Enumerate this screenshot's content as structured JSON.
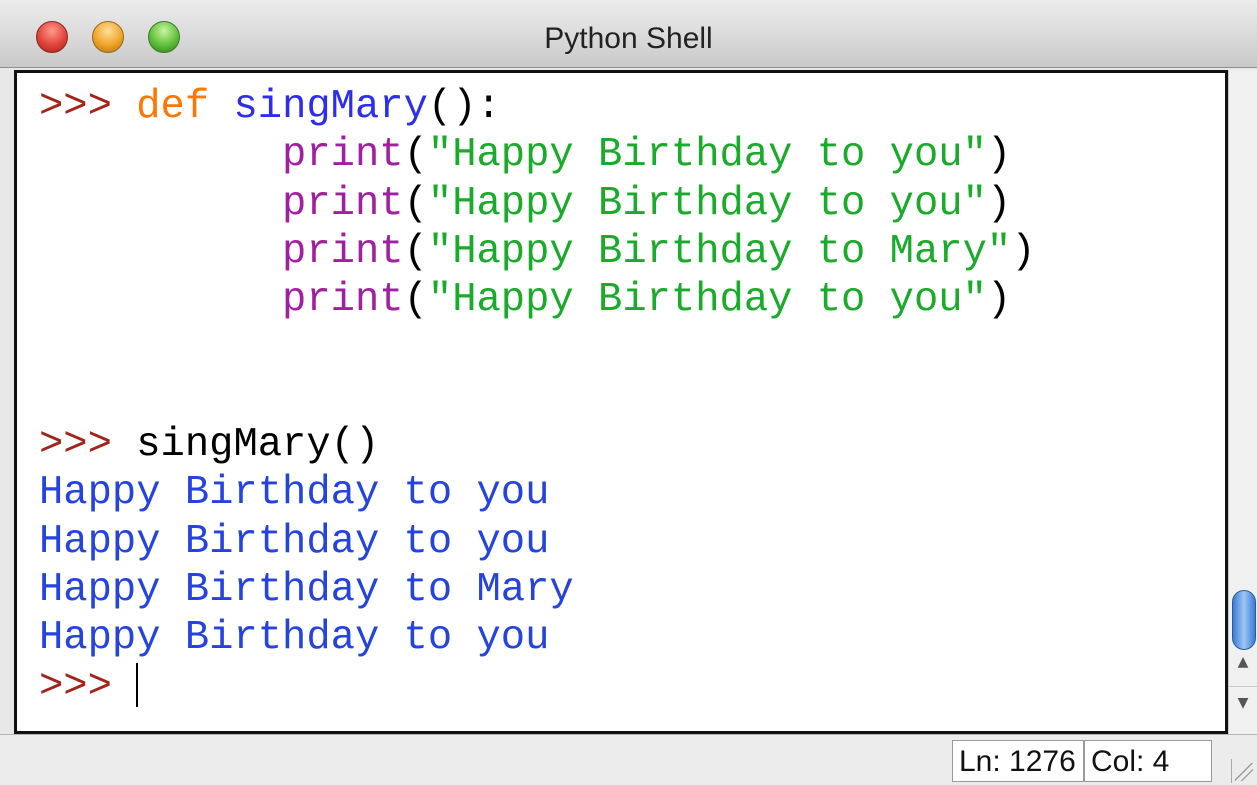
{
  "window": {
    "title": "Python Shell",
    "traffic_lights": [
      "close",
      "minimize",
      "zoom"
    ]
  },
  "shell": {
    "prompt": ">>>",
    "definition": {
      "keyword": "def",
      "function_name": "singMary",
      "signature_rest": "():",
      "body": [
        {
          "builtin": "print",
          "open": "(",
          "string": "\"Happy Birthday to you\"",
          "close": ")"
        },
        {
          "builtin": "print",
          "open": "(",
          "string": "\"Happy Birthday to you\"",
          "close": ")"
        },
        {
          "builtin": "print",
          "open": "(",
          "string": "\"Happy Birthday to Mary\"",
          "close": ")"
        },
        {
          "builtin": "print",
          "open": "(",
          "string": "\"Happy Birthday to you\"",
          "close": ")"
        }
      ]
    },
    "call": "singMary()",
    "output": [
      "Happy Birthday to you",
      "Happy Birthday to you",
      "Happy Birthday to Mary",
      "Happy Birthday to you"
    ]
  },
  "status": {
    "line": "Ln: 1276",
    "column": "Col: 4"
  },
  "colors": {
    "prompt": "#a3241a",
    "keyword": "#ff7700",
    "function_name": "#2d2df0",
    "builtin": "#a21fa2",
    "string": "#1aab2a",
    "output": "#2443e0"
  },
  "icons": [
    "close-icon",
    "minimize-icon",
    "zoom-icon",
    "scroll-up-icon",
    "scroll-down-icon",
    "resize-grip-icon"
  ]
}
